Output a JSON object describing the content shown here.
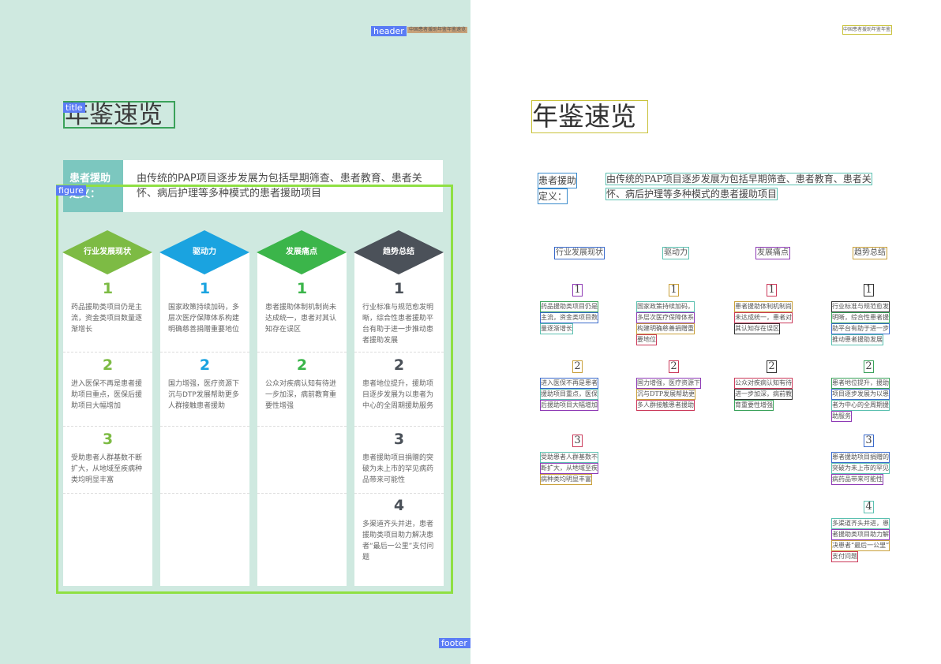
{
  "header_text": "中国患者援助年鉴年鉴速览",
  "title": "年鉴速览",
  "definition": {
    "label": "患者援助定义：",
    "label_lines": [
      "患者援助",
      "定义："
    ],
    "text": "由传统的PAP项目逐步发展为包括早期筛查、患者教育、患者关怀、病后护理等多种模式的患者援助项目",
    "text_lines": [
      "由传统的PAP项目逐步发展为包括早期筛查、患者教育、患者关",
      "怀、病后护理等多种模式的患者援助项目"
    ]
  },
  "annotations": {
    "header": "header",
    "title": "title",
    "figure": "figure",
    "footer": "footer"
  },
  "colors": {
    "background": "#cfe9e0",
    "green": "#7dbb44",
    "blue": "#1aa3e0",
    "green2": "#3bb54a",
    "dark": "#4b5159",
    "label_teal": "#7cc7bf"
  },
  "columns": [
    {
      "heading": "行业发展现状",
      "color": "#7dbb44",
      "items": [
        {
          "num": "1",
          "text": "药品援助类项目仍是主流，资金类项目数量逐渐增长",
          "lines": [
            "药品援助类项目仍是",
            "主流，资金类项目数",
            "量逐渐增长"
          ]
        },
        {
          "num": "2",
          "text": "进入医保不再是患者援助项目重点，医保后援助项目大幅增加",
          "lines": [
            "进入医保不再是患者",
            "援助项目重点，医保",
            "后援助项目大幅增加"
          ]
        },
        {
          "num": "3",
          "text": "受助患者人群基数不断扩大，从地域至疾病种类均明显丰富",
          "lines": [
            "受助患者人群基数不",
            "断扩大，从地域至疾",
            "病种类均明显丰富"
          ]
        }
      ]
    },
    {
      "heading": "驱动力",
      "color": "#1aa3e0",
      "items": [
        {
          "num": "1",
          "text": "国家政策持续加码，多层次医疗保障体系构建明确慈善捐赠重要地位",
          "lines": [
            "国家政策持续加码，",
            "多层次医疗保障体系",
            "构建明确慈善捐赠重",
            "要地位"
          ]
        },
        {
          "num": "2",
          "text": "国力增强，医疗资源下沉与DTP发展帮助更多人群接触患者援助",
          "lines": [
            "国力增强，医疗资源下",
            "沉与DTP发展帮助更",
            "多人群接触患者援助"
          ]
        }
      ]
    },
    {
      "heading": "发展痛点",
      "color": "#3bb54a",
      "items": [
        {
          "num": "1",
          "text": "患者援助体制机制尚未达成统一，患者对其认知存在误区",
          "lines": [
            "患者援助体制机制尚",
            "未达成统一，患者对",
            "其认知存在误区"
          ]
        },
        {
          "num": "2",
          "text": "公众对疾病认知有待进一步加深，病前教育重要性增强",
          "lines": [
            "公众对疾病认知有待",
            "进一步加深，病前教",
            "育重要性增强"
          ]
        }
      ]
    },
    {
      "heading": "趋势总结",
      "color": "#4b5159",
      "items": [
        {
          "num": "1",
          "text": "行业标准与规范愈发明晰，综合性患者援助平台有助于进一步推动患者援助发展",
          "lines": [
            "行业标准与规范愈发",
            "明晰，综合性患者援",
            "助平台有助于进一步",
            "推动患者援助发展"
          ]
        },
        {
          "num": "2",
          "text": "患者地位提升，援助项目逐步发展为以患者为中心的全周期援助服务",
          "lines": [
            "患者地位提升，援助",
            "项目逐步发展为以患",
            "者为中心的全周期援",
            "助服务"
          ]
        },
        {
          "num": "3",
          "text": "患者援助项目捐赠的突破为未上市的罕见病药品带来可能性",
          "lines": [
            "患者援助项目捐赠的",
            "突破为未上市的罕见",
            "病药品带来可能性"
          ]
        },
        {
          "num": "4",
          "text": "多渠道齐头并进，患者援助类项目助力解决患者“最后一公里”支付问题",
          "lines": [
            "多渠道齐头并进，患",
            "者援助类项目助力解",
            "决患者“最后一公里”",
            "支付问题"
          ]
        }
      ]
    }
  ]
}
